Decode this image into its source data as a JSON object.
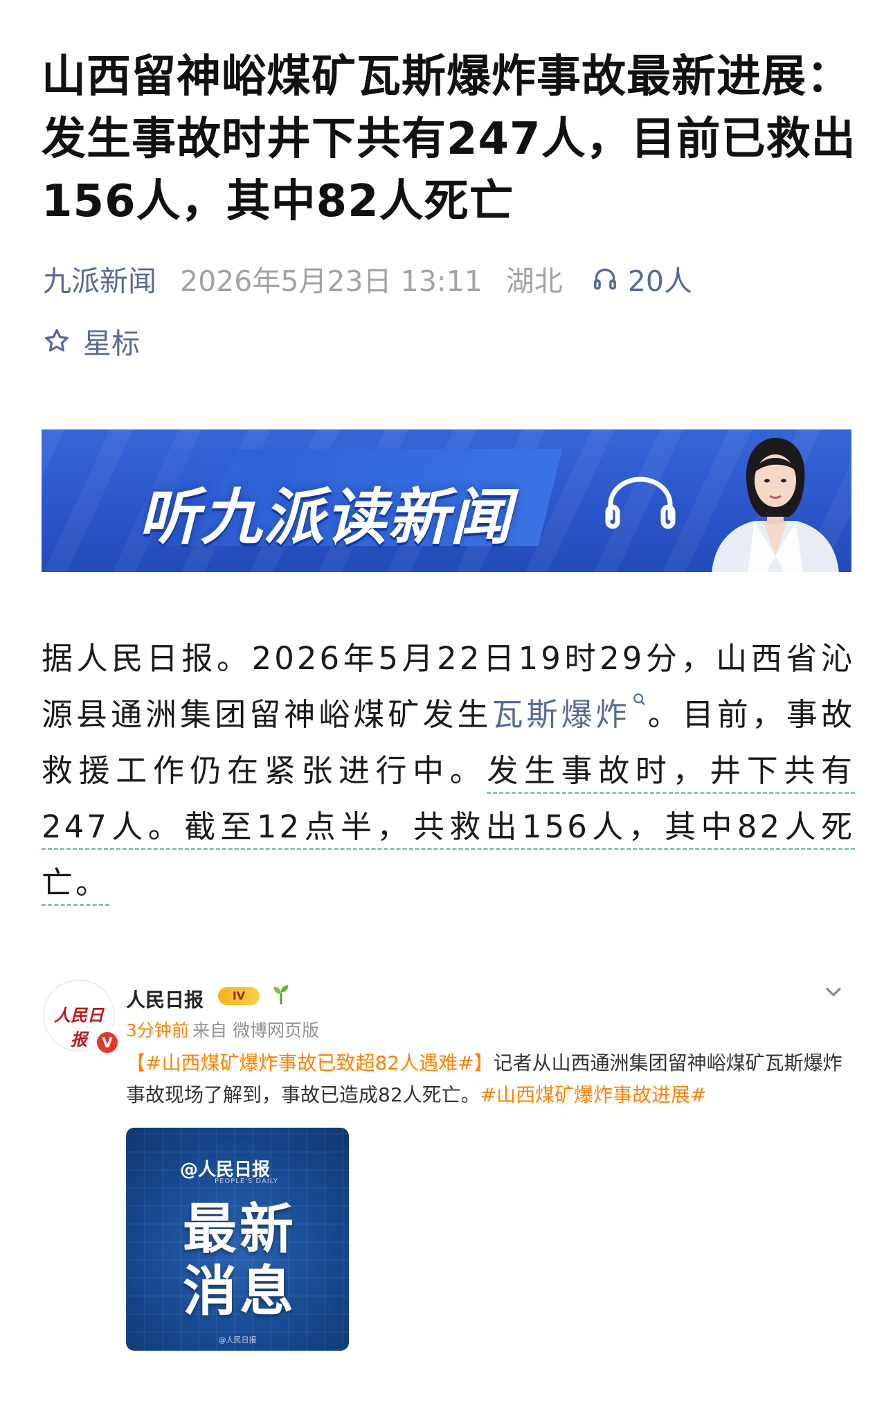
{
  "article": {
    "title": "山西留神峪煤矿瓦斯爆炸事故最新进展：发生事故时井下共有247人，目前已救出156人，其中82人死亡",
    "source": "九派新闻",
    "datetime": "2026年5月23日 13:11",
    "location": "湖北",
    "listeners": "20人",
    "star_label": "星标",
    "body_part1": "据人民日报。2026年5月22日19时29分，山西省沁源县通洲集团留神峪煤矿发生",
    "body_keyword": "瓦斯爆炸",
    "body_part2": "。目前，事故救援工作仍在紧张进行中。",
    "body_part3": "发生事故时，井下共有247人。截至12点半，共救出156人，其中82人死亡。"
  },
  "banner": {
    "text": "听九派读新闻",
    "colors": {
      "background": "#2a55c8",
      "text": "#ffffff"
    }
  },
  "weibo": {
    "avatar_logo": "人民日报",
    "account_name": "人民日报",
    "badge": "IV",
    "time": "3分钟前",
    "from": "来自 微博网页版",
    "tag1": "【#山西煤矿爆炸事故已致超82人遇难#】",
    "text": "记者从山西通洲集团留神峪煤矿瓦斯爆炸事故现场了解到，事故已造成82人死亡。",
    "tag2": "#山西煤矿爆炸事故进展#",
    "image": {
      "brand": "@人民日报",
      "brand_en": "PEOPLE'S DAILY",
      "headline_line1": "最新",
      "headline_line2": "消息",
      "watermark": "@人民日报"
    }
  },
  "colors": {
    "link": "#576b95",
    "meta_gray": "#a3a3a3",
    "weibo_orange": "#ff8200",
    "underline_green": "#7fcba6"
  },
  "icons": [
    "headphones-icon",
    "star-icon",
    "search-mini-icon",
    "verified-v-icon",
    "sprout-icon",
    "chevron-down-icon"
  ]
}
